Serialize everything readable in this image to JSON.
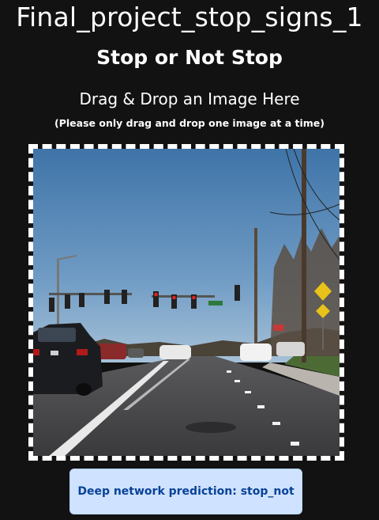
{
  "app": {
    "title": "Final_project_stop_signs_1",
    "subtitle": "Stop or Not Stop"
  },
  "drop_zone": {
    "heading": "Drag & Drop an Image Here",
    "note": "(Please only drag and drop one image at a time)",
    "image": {
      "label": "street scene with traffic lights and cars"
    }
  },
  "prediction": {
    "text": "Deep network prediction: stop_not"
  },
  "colors": {
    "page_background": "#121212",
    "prediction_bg": "#cfe2ff",
    "prediction_text": "#084298"
  }
}
